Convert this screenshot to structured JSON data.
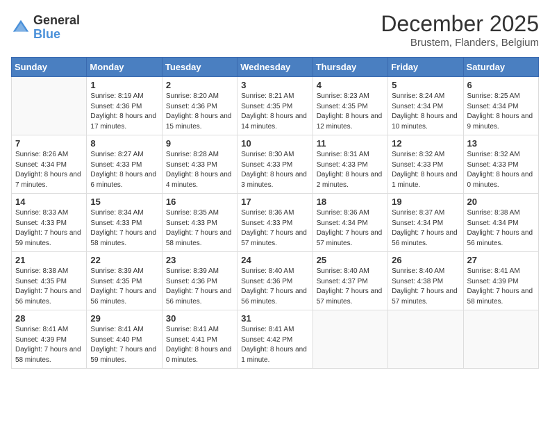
{
  "header": {
    "logo_general": "General",
    "logo_blue": "Blue",
    "month_title": "December 2025",
    "location": "Brustem, Flanders, Belgium"
  },
  "days_of_week": [
    "Sunday",
    "Monday",
    "Tuesday",
    "Wednesday",
    "Thursday",
    "Friday",
    "Saturday"
  ],
  "weeks": [
    [
      {
        "num": "",
        "sunrise": "",
        "sunset": "",
        "daylight": "",
        "empty": true
      },
      {
        "num": "1",
        "sunrise": "Sunrise: 8:19 AM",
        "sunset": "Sunset: 4:36 PM",
        "daylight": "Daylight: 8 hours and 17 minutes."
      },
      {
        "num": "2",
        "sunrise": "Sunrise: 8:20 AM",
        "sunset": "Sunset: 4:36 PM",
        "daylight": "Daylight: 8 hours and 15 minutes."
      },
      {
        "num": "3",
        "sunrise": "Sunrise: 8:21 AM",
        "sunset": "Sunset: 4:35 PM",
        "daylight": "Daylight: 8 hours and 14 minutes."
      },
      {
        "num": "4",
        "sunrise": "Sunrise: 8:23 AM",
        "sunset": "Sunset: 4:35 PM",
        "daylight": "Daylight: 8 hours and 12 minutes."
      },
      {
        "num": "5",
        "sunrise": "Sunrise: 8:24 AM",
        "sunset": "Sunset: 4:34 PM",
        "daylight": "Daylight: 8 hours and 10 minutes."
      },
      {
        "num": "6",
        "sunrise": "Sunrise: 8:25 AM",
        "sunset": "Sunset: 4:34 PM",
        "daylight": "Daylight: 8 hours and 9 minutes."
      }
    ],
    [
      {
        "num": "7",
        "sunrise": "Sunrise: 8:26 AM",
        "sunset": "Sunset: 4:34 PM",
        "daylight": "Daylight: 8 hours and 7 minutes."
      },
      {
        "num": "8",
        "sunrise": "Sunrise: 8:27 AM",
        "sunset": "Sunset: 4:33 PM",
        "daylight": "Daylight: 8 hours and 6 minutes."
      },
      {
        "num": "9",
        "sunrise": "Sunrise: 8:28 AM",
        "sunset": "Sunset: 4:33 PM",
        "daylight": "Daylight: 8 hours and 4 minutes."
      },
      {
        "num": "10",
        "sunrise": "Sunrise: 8:30 AM",
        "sunset": "Sunset: 4:33 PM",
        "daylight": "Daylight: 8 hours and 3 minutes."
      },
      {
        "num": "11",
        "sunrise": "Sunrise: 8:31 AM",
        "sunset": "Sunset: 4:33 PM",
        "daylight": "Daylight: 8 hours and 2 minutes."
      },
      {
        "num": "12",
        "sunrise": "Sunrise: 8:32 AM",
        "sunset": "Sunset: 4:33 PM",
        "daylight": "Daylight: 8 hours and 1 minute."
      },
      {
        "num": "13",
        "sunrise": "Sunrise: 8:32 AM",
        "sunset": "Sunset: 4:33 PM",
        "daylight": "Daylight: 8 hours and 0 minutes."
      }
    ],
    [
      {
        "num": "14",
        "sunrise": "Sunrise: 8:33 AM",
        "sunset": "Sunset: 4:33 PM",
        "daylight": "Daylight: 7 hours and 59 minutes."
      },
      {
        "num": "15",
        "sunrise": "Sunrise: 8:34 AM",
        "sunset": "Sunset: 4:33 PM",
        "daylight": "Daylight: 7 hours and 58 minutes."
      },
      {
        "num": "16",
        "sunrise": "Sunrise: 8:35 AM",
        "sunset": "Sunset: 4:33 PM",
        "daylight": "Daylight: 7 hours and 58 minutes."
      },
      {
        "num": "17",
        "sunrise": "Sunrise: 8:36 AM",
        "sunset": "Sunset: 4:33 PM",
        "daylight": "Daylight: 7 hours and 57 minutes."
      },
      {
        "num": "18",
        "sunrise": "Sunrise: 8:36 AM",
        "sunset": "Sunset: 4:34 PM",
        "daylight": "Daylight: 7 hours and 57 minutes."
      },
      {
        "num": "19",
        "sunrise": "Sunrise: 8:37 AM",
        "sunset": "Sunset: 4:34 PM",
        "daylight": "Daylight: 7 hours and 56 minutes."
      },
      {
        "num": "20",
        "sunrise": "Sunrise: 8:38 AM",
        "sunset": "Sunset: 4:34 PM",
        "daylight": "Daylight: 7 hours and 56 minutes."
      }
    ],
    [
      {
        "num": "21",
        "sunrise": "Sunrise: 8:38 AM",
        "sunset": "Sunset: 4:35 PM",
        "daylight": "Daylight: 7 hours and 56 minutes."
      },
      {
        "num": "22",
        "sunrise": "Sunrise: 8:39 AM",
        "sunset": "Sunset: 4:35 PM",
        "daylight": "Daylight: 7 hours and 56 minutes."
      },
      {
        "num": "23",
        "sunrise": "Sunrise: 8:39 AM",
        "sunset": "Sunset: 4:36 PM",
        "daylight": "Daylight: 7 hours and 56 minutes."
      },
      {
        "num": "24",
        "sunrise": "Sunrise: 8:40 AM",
        "sunset": "Sunset: 4:36 PM",
        "daylight": "Daylight: 7 hours and 56 minutes."
      },
      {
        "num": "25",
        "sunrise": "Sunrise: 8:40 AM",
        "sunset": "Sunset: 4:37 PM",
        "daylight": "Daylight: 7 hours and 57 minutes."
      },
      {
        "num": "26",
        "sunrise": "Sunrise: 8:40 AM",
        "sunset": "Sunset: 4:38 PM",
        "daylight": "Daylight: 7 hours and 57 minutes."
      },
      {
        "num": "27",
        "sunrise": "Sunrise: 8:41 AM",
        "sunset": "Sunset: 4:39 PM",
        "daylight": "Daylight: 7 hours and 58 minutes."
      }
    ],
    [
      {
        "num": "28",
        "sunrise": "Sunrise: 8:41 AM",
        "sunset": "Sunset: 4:39 PM",
        "daylight": "Daylight: 7 hours and 58 minutes."
      },
      {
        "num": "29",
        "sunrise": "Sunrise: 8:41 AM",
        "sunset": "Sunset: 4:40 PM",
        "daylight": "Daylight: 7 hours and 59 minutes."
      },
      {
        "num": "30",
        "sunrise": "Sunrise: 8:41 AM",
        "sunset": "Sunset: 4:41 PM",
        "daylight": "Daylight: 8 hours and 0 minutes."
      },
      {
        "num": "31",
        "sunrise": "Sunrise: 8:41 AM",
        "sunset": "Sunset: 4:42 PM",
        "daylight": "Daylight: 8 hours and 1 minute."
      },
      {
        "num": "",
        "sunrise": "",
        "sunset": "",
        "daylight": "",
        "empty": true
      },
      {
        "num": "",
        "sunrise": "",
        "sunset": "",
        "daylight": "",
        "empty": true
      },
      {
        "num": "",
        "sunrise": "",
        "sunset": "",
        "daylight": "",
        "empty": true
      }
    ]
  ]
}
